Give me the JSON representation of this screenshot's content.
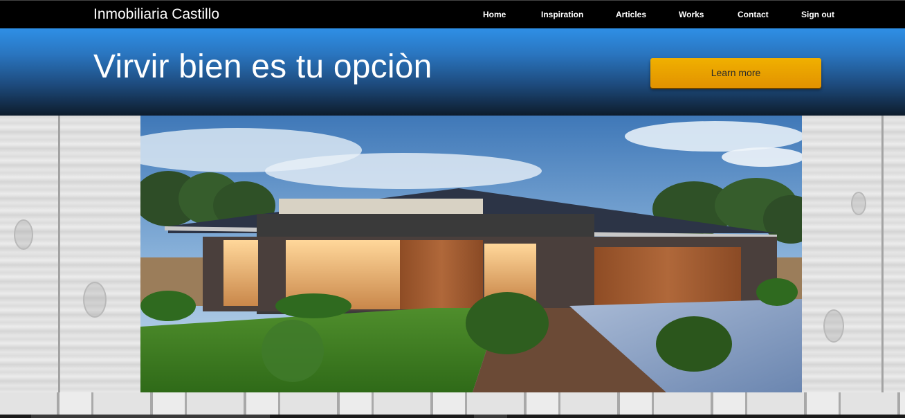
{
  "header": {
    "brand": "Inmobiliaria Castillo",
    "nav": [
      {
        "label": "Home"
      },
      {
        "label": "Inspiration"
      },
      {
        "label": "Articles"
      },
      {
        "label": "Works"
      },
      {
        "label": "Contact"
      },
      {
        "label": "Sign out"
      }
    ]
  },
  "hero": {
    "title": "Virvir bien es tu opciòn",
    "cta_label": "Learn more"
  },
  "colors": {
    "topbar": "#000000",
    "hero_top": "#2e8fe6",
    "hero_bottom": "#0d1c2c",
    "cta": "#e8a100"
  },
  "media": {
    "image_alt_icon": "house-photo"
  }
}
